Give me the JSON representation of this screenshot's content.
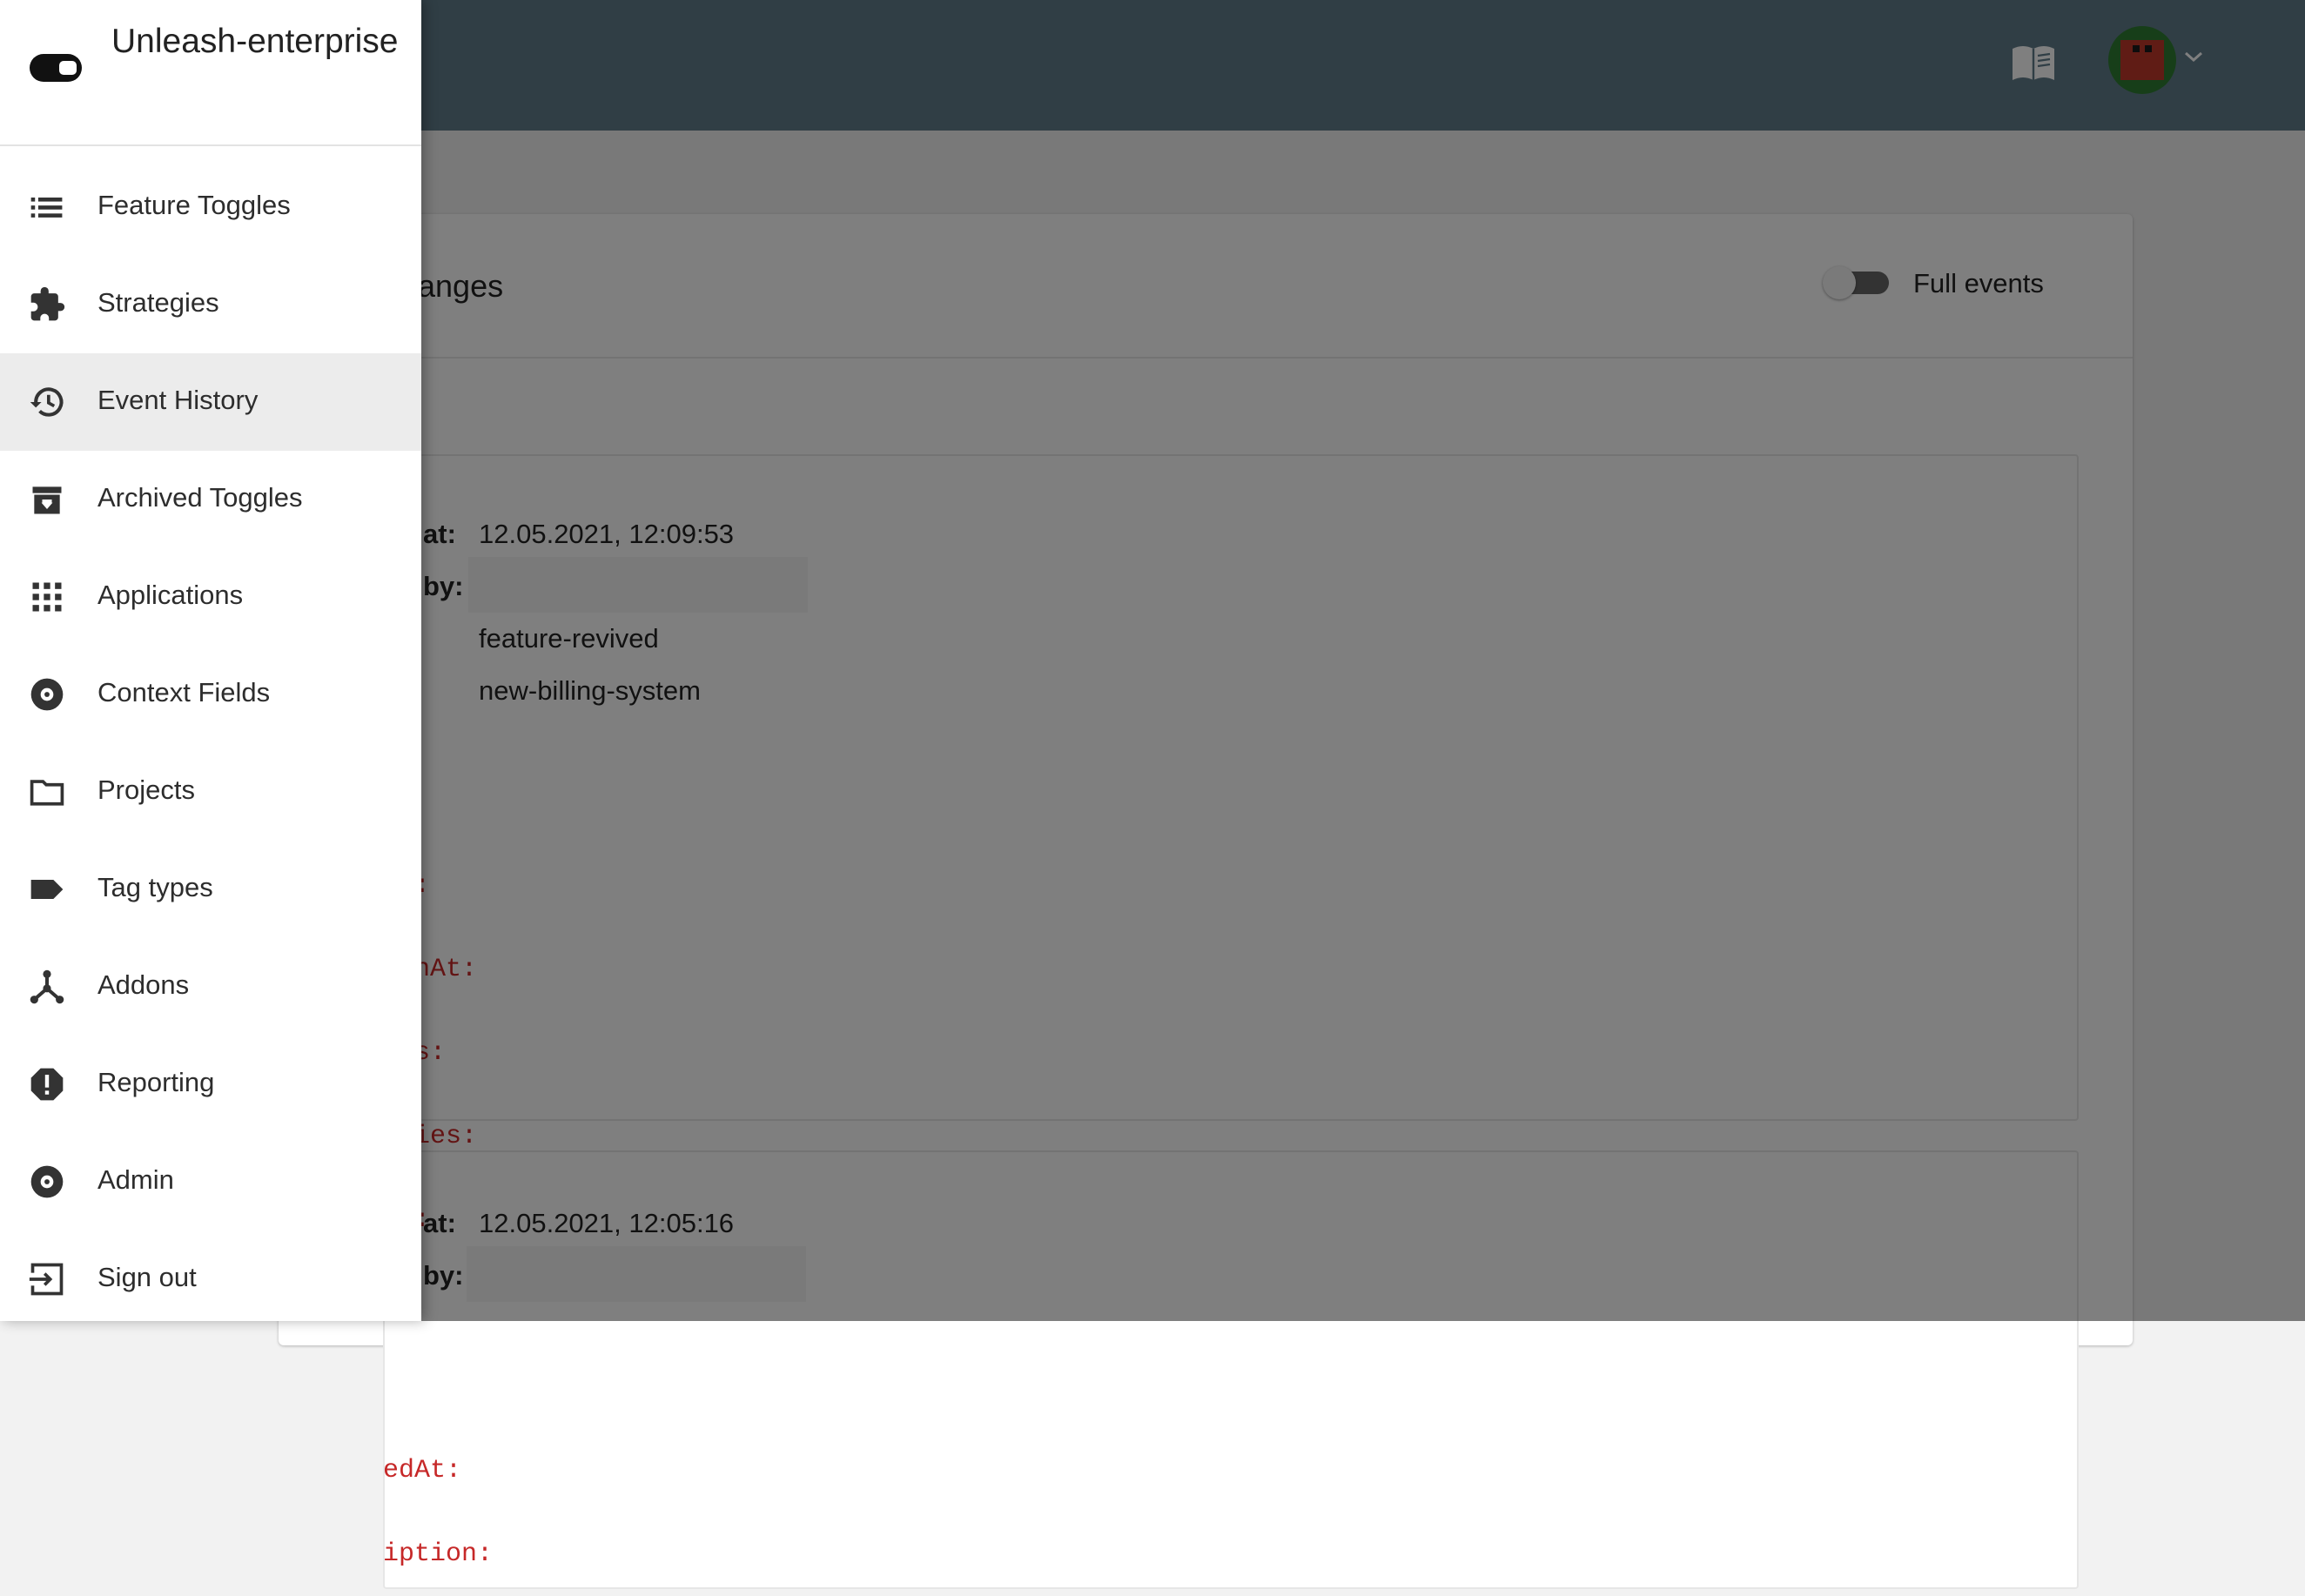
{
  "drawer": {
    "brand_name": "Unleash-enterprise",
    "items": [
      {
        "label": "Feature Toggles",
        "icon": "list-icon"
      },
      {
        "label": "Strategies",
        "icon": "puzzle-icon"
      },
      {
        "label": "Event History",
        "icon": "history-icon"
      },
      {
        "label": "Archived Toggles",
        "icon": "archive-icon"
      },
      {
        "label": "Applications",
        "icon": "apps-grid-icon"
      },
      {
        "label": "Context Fields",
        "icon": "album-icon"
      },
      {
        "label": "Projects",
        "icon": "folder-icon"
      },
      {
        "label": "Tag types",
        "icon": "label-icon"
      },
      {
        "label": "Addons",
        "icon": "device-hub-icon"
      },
      {
        "label": "Reporting",
        "icon": "report-icon"
      },
      {
        "label": "Admin",
        "icon": "album-icon"
      },
      {
        "label": "Sign out",
        "icon": "exit-icon"
      }
    ],
    "active_item": "Event History"
  },
  "header": {
    "docs_icon": "book-icon",
    "avatar_icon": "avatar-icon"
  },
  "main": {
    "title_fragment": "anges",
    "full_events_label": "Full events",
    "events": [
      {
        "changed_at_label": "at:",
        "changed_at": "12.05.2021, 12:09:53",
        "changed_by_label": "by:",
        "type": "feature-revived",
        "name": "new-billing-system",
        "diff_keys": [
          "ed:",
          "eenAt:",
          "nts:",
          "egies:",
          "ct:",
          ":",
          "",
          "edAt:",
          "iption:"
        ]
      },
      {
        "changed_at_label": "at:",
        "changed_at": "12.05.2021, 12:05:16",
        "changed_by_label": "by:"
      }
    ]
  },
  "colors": {
    "appbar": "#607d8b",
    "active_item_bg": "#ececec",
    "diff_text": "#c62828"
  }
}
